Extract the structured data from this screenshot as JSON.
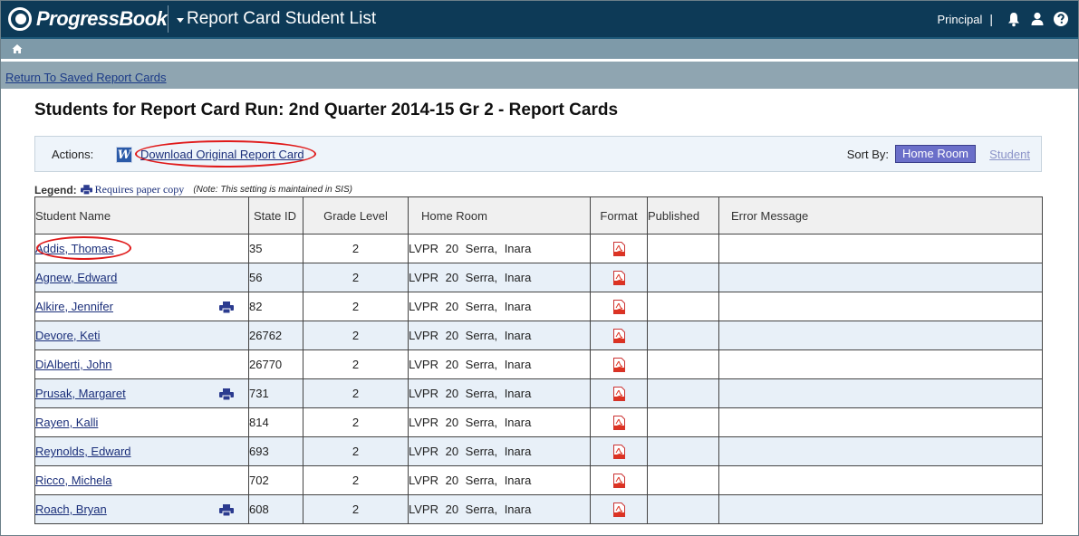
{
  "header": {
    "logo_text": "ProgressBook",
    "app_title": "Report Card Student List",
    "role": "Principal",
    "separator": "|"
  },
  "breadcrumb": {
    "return_link": "Return To Saved Report Cards"
  },
  "page": {
    "title": "Students for Report Card Run: 2nd Quarter 2014-15 Gr 2 - Report Cards"
  },
  "actions": {
    "label": "Actions:",
    "word_icon": "W",
    "download_label": "Download Original Report Card",
    "sort_label": "Sort By:",
    "sort_home": "Home Room",
    "sort_student": "Student"
  },
  "legend": {
    "title": "Legend:",
    "item": "Requires paper copy",
    "note": "(Note: This setting is maintained in SIS)"
  },
  "table": {
    "columns": {
      "name": "Student Name",
      "state_id": "State ID",
      "grade": "Grade Level",
      "home": "Home Room",
      "format": "Format",
      "published": "Published",
      "error": "Error Message"
    },
    "rows": [
      {
        "name": "Addis, Thomas",
        "state_id": "35",
        "grade": "2",
        "home": "LVPR 20 Serra, Inara",
        "paper": false
      },
      {
        "name": "Agnew, Edward",
        "state_id": "56",
        "grade": "2",
        "home": "LVPR 20 Serra, Inara",
        "paper": false
      },
      {
        "name": "Alkire, Jennifer",
        "state_id": "82",
        "grade": "2",
        "home": "LVPR 20 Serra, Inara",
        "paper": true
      },
      {
        "name": "Devore, Keti",
        "state_id": "26762",
        "grade": "2",
        "home": "LVPR 20 Serra, Inara",
        "paper": false
      },
      {
        "name": "DiAlberti, John",
        "state_id": "26770",
        "grade": "2",
        "home": "LVPR 20 Serra, Inara",
        "paper": false
      },
      {
        "name": "Prusak, Margaret",
        "state_id": "731",
        "grade": "2",
        "home": "LVPR 20 Serra, Inara",
        "paper": true
      },
      {
        "name": "Rayen, Kalli",
        "state_id": "814",
        "grade": "2",
        "home": "LVPR 20 Serra, Inara",
        "paper": false
      },
      {
        "name": "Reynolds, Edward",
        "state_id": "693",
        "grade": "2",
        "home": "LVPR 20 Serra, Inara",
        "paper": false
      },
      {
        "name": "Ricco, Michela",
        "state_id": "702",
        "grade": "2",
        "home": "LVPR 20 Serra, Inara",
        "paper": false
      },
      {
        "name": "Roach, Bryan",
        "state_id": "608",
        "grade": "2",
        "home": "LVPR 20 Serra, Inara",
        "paper": true
      }
    ]
  },
  "icons": {
    "logo": "progressbook-logo-icon",
    "bell": "bell-icon",
    "user": "user-icon",
    "help": "help-icon",
    "home": "home-icon",
    "word": "word-document-icon",
    "printer": "printer-icon",
    "pdf": "pdf-icon"
  },
  "colors": {
    "topbar": "#0d3a57",
    "nav": "#7e9aa9",
    "link": "#1b2f7a",
    "sort_active": "#6b6fc9",
    "annotation": "#e01a1a",
    "alt_row": "#e8f0f8"
  }
}
